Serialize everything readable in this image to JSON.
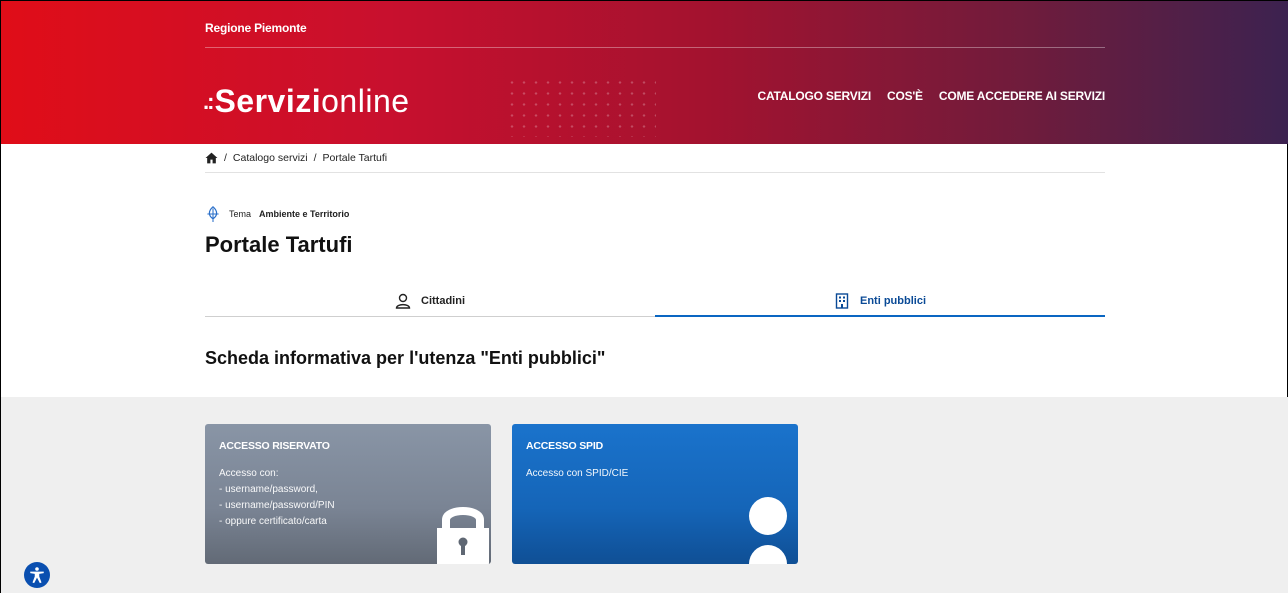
{
  "header": {
    "region": "Regione Piemonte",
    "logo_bold": "Servizi",
    "logo_light": "online",
    "nav": [
      "CATALOGO SERVIZI",
      "COS'È",
      "COME ACCEDERE AI SERVIZI"
    ]
  },
  "breadcrumb": {
    "separator": "/",
    "items": [
      "Catalogo servizi",
      "Portale Tartufi"
    ]
  },
  "theme": {
    "label": "Tema",
    "value": "Ambiente e Territorio"
  },
  "page_title": "Portale Tartufi",
  "tabs": [
    {
      "label": "Cittadini",
      "active": false
    },
    {
      "label": "Enti pubblici",
      "active": true
    }
  ],
  "section_title": "Scheda informativa per l'utenza \"Enti pubblici\"",
  "cards": {
    "reserved": {
      "title": "ACCESSO RISERVATO",
      "lines": [
        "Accesso con:",
        "- username/password,",
        "- username/password/PIN",
        "- oppure certificato/carta"
      ]
    },
    "spid": {
      "title": "ACCESSO SPID",
      "lines": [
        "Accesso con SPID/CIE"
      ]
    }
  },
  "colors": {
    "header_start": "#e00d18",
    "header_end": "#3c2250",
    "accent_blue": "#0a66c2",
    "card_gray": "#7a8494",
    "card_blue": "#1565b8"
  },
  "icons": [
    "home-icon",
    "leaf-icon",
    "user-icon",
    "building-icon",
    "lock-icon",
    "person-icon",
    "accessibility-icon"
  ]
}
